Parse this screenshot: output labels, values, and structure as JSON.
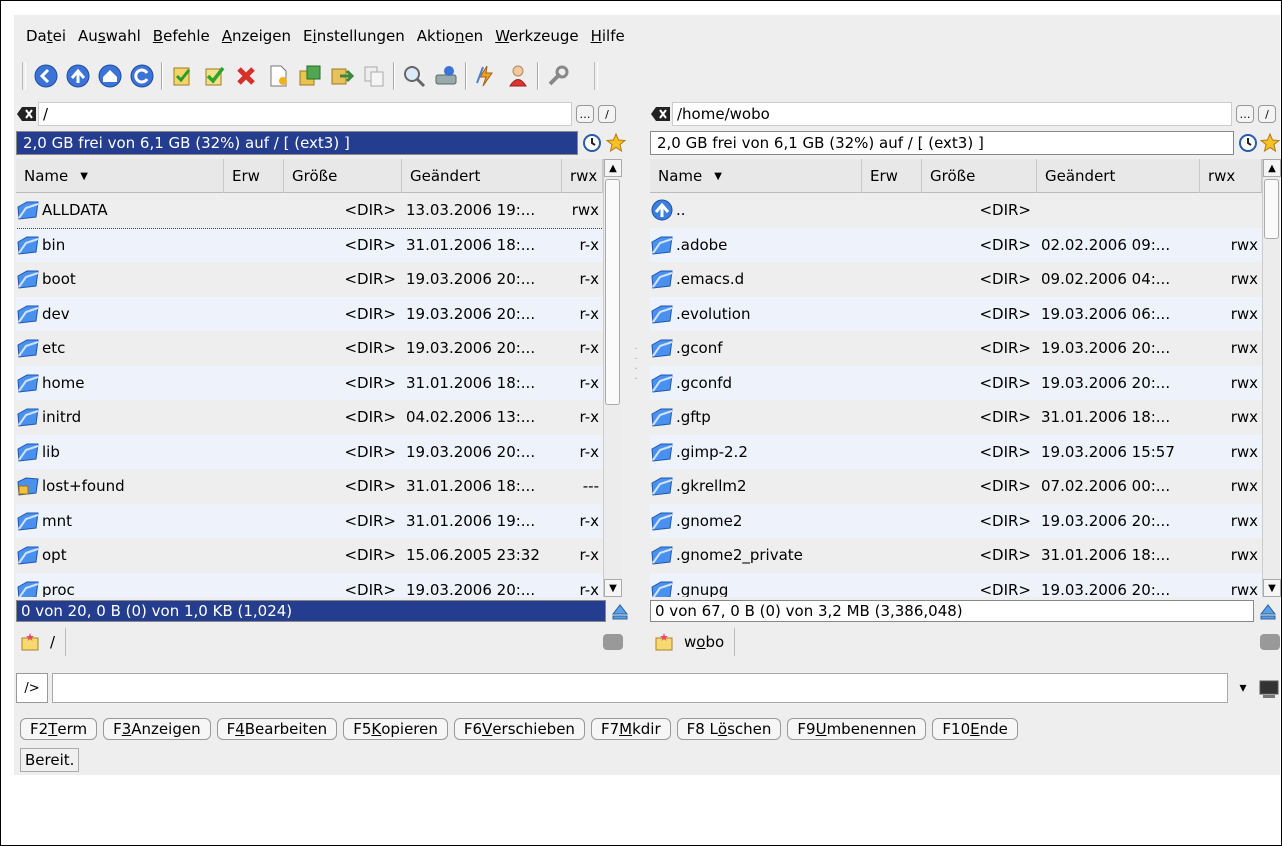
{
  "menubar": {
    "items": [
      {
        "pre": "Da",
        "acc": "t",
        "post": "ei"
      },
      {
        "pre": "Au",
        "acc": "s",
        "post": "wahl"
      },
      {
        "pre": "",
        "acc": "B",
        "post": "efehle"
      },
      {
        "pre": "",
        "acc": "A",
        "post": "nzeigen"
      },
      {
        "pre": "E",
        "acc": "i",
        "post": "nstellungen"
      },
      {
        "pre": "Aktio",
        "acc": "n",
        "post": "en"
      },
      {
        "pre": "",
        "acc": "W",
        "post": "erkzeuge"
      },
      {
        "pre": "",
        "acc": "H",
        "post": "ilfe"
      }
    ]
  },
  "toolbar": {
    "icons": [
      "back-icon",
      "up-icon",
      "home-icon",
      "refresh-icon",
      "select-icon",
      "check-icon",
      "cancel-icon",
      "new-file-icon",
      "copy-icon",
      "move-icon",
      "duplicate-icon",
      "find-icon",
      "disk-icon",
      "sync-icon",
      "user-icon",
      "tools-icon"
    ]
  },
  "left": {
    "path": "/",
    "info": "2,0 GB frei von 6,1 GB (32%) auf / [ (ext3) ]",
    "headers": {
      "name": "Name",
      "ext": "Erw",
      "size": "Größe",
      "date": "Geändert",
      "perm": "rwx"
    },
    "files": [
      {
        "name": "ALLDATA",
        "size": "<DIR>",
        "date": "13.03.2006 19:...",
        "perm": "rwx"
      },
      {
        "name": "bin",
        "size": "<DIR>",
        "date": "31.01.2006 18:...",
        "perm": "r-x"
      },
      {
        "name": "boot",
        "size": "<DIR>",
        "date": "19.03.2006 20:...",
        "perm": "r-x"
      },
      {
        "name": "dev",
        "size": "<DIR>",
        "date": "19.03.2006 20:...",
        "perm": "r-x"
      },
      {
        "name": "etc",
        "size": "<DIR>",
        "date": "19.03.2006 20:...",
        "perm": "r-x"
      },
      {
        "name": "home",
        "size": "<DIR>",
        "date": "31.01.2006 18:...",
        "perm": "r-x"
      },
      {
        "name": "initrd",
        "size": "<DIR>",
        "date": "04.02.2006 13:...",
        "perm": "r-x"
      },
      {
        "name": "lib",
        "size": "<DIR>",
        "date": "19.03.2006 20:...",
        "perm": "r-x"
      },
      {
        "name": "lost+found",
        "size": "<DIR>",
        "date": "31.01.2006 18:...",
        "perm": "---"
      },
      {
        "name": "mnt",
        "size": "<DIR>",
        "date": "31.01.2006 19:...",
        "perm": "r-x"
      },
      {
        "name": "opt",
        "size": "<DIR>",
        "date": "15.06.2005 23:32",
        "perm": "r-x"
      },
      {
        "name": "proc",
        "size": "<DIR>",
        "date": "19.03.2006 20:...",
        "perm": "r-x"
      }
    ],
    "status": "0 von 20,  0 B (0) von 1,0 KB (1,024)",
    "tab": "/"
  },
  "right": {
    "path": "/home/wobo",
    "info": "2,0 GB frei von 6,1 GB (32%) auf / [ (ext3) ]",
    "headers": {
      "name": "Name",
      "ext": "Erw",
      "size": "Größe",
      "date": "Geändert",
      "perm": "rwx"
    },
    "files": [
      {
        "name": "..",
        "size": "<DIR>",
        "date": "",
        "perm": ""
      },
      {
        "name": ".adobe",
        "size": "<DIR>",
        "date": "02.02.2006 09:...",
        "perm": "rwx"
      },
      {
        "name": ".emacs.d",
        "size": "<DIR>",
        "date": "09.02.2006 04:...",
        "perm": "rwx"
      },
      {
        "name": ".evolution",
        "size": "<DIR>",
        "date": "19.03.2006 06:...",
        "perm": "rwx"
      },
      {
        "name": ".gconf",
        "size": "<DIR>",
        "date": "19.03.2006 20:...",
        "perm": "rwx"
      },
      {
        "name": ".gconfd",
        "size": "<DIR>",
        "date": "19.03.2006 20:...",
        "perm": "rwx"
      },
      {
        "name": ".gftp",
        "size": "<DIR>",
        "date": "31.01.2006 18:...",
        "perm": "rwx"
      },
      {
        "name": ".gimp-2.2",
        "size": "<DIR>",
        "date": "19.03.2006 15:57",
        "perm": "rwx"
      },
      {
        "name": ".gkrellm2",
        "size": "<DIR>",
        "date": "07.02.2006 00:...",
        "perm": "rwx"
      },
      {
        "name": ".gnome2",
        "size": "<DIR>",
        "date": "19.03.2006 20:...",
        "perm": "rwx"
      },
      {
        "name": ".gnome2_private",
        "size": "<DIR>",
        "date": "31.01.2006 18:...",
        "perm": "rwx"
      },
      {
        "name": ".gnupg",
        "size": "<DIR>",
        "date": "19.03.2006 20:...",
        "perm": "rwx"
      }
    ],
    "status": "0 von 67,  0 B (0) von 3,2 MB (3,386,048)",
    "tab_pre": "w",
    "tab_acc": "o",
    "tab_post": "bo"
  },
  "cmdline": {
    "prompt": "/>"
  },
  "fkeys": [
    {
      "pre": "F2 ",
      "acc": "T",
      "post": "erm"
    },
    {
      "pre": "F",
      "acc": "3",
      "post": " Anzeigen"
    },
    {
      "pre": "F",
      "acc": "4",
      "post": " Bearbeiten"
    },
    {
      "pre": "F5 ",
      "acc": "K",
      "post": "opieren"
    },
    {
      "pre": "F6 ",
      "acc": "V",
      "post": "erschieben"
    },
    {
      "pre": "F7 ",
      "acc": "M",
      "post": "kdir"
    },
    {
      "pre": "F8 L",
      "acc": "ö",
      "post": "schen"
    },
    {
      "pre": "F9 ",
      "acc": "U",
      "post": "mbenennen"
    },
    {
      "pre": "F10 ",
      "acc": "E",
      "post": "nde"
    }
  ],
  "statusbar": {
    "text": "Bereit."
  },
  "colors": {
    "active_bar": "#253d8e",
    "row_alt": "#eef2fa",
    "folder": "#2f6fd8"
  }
}
